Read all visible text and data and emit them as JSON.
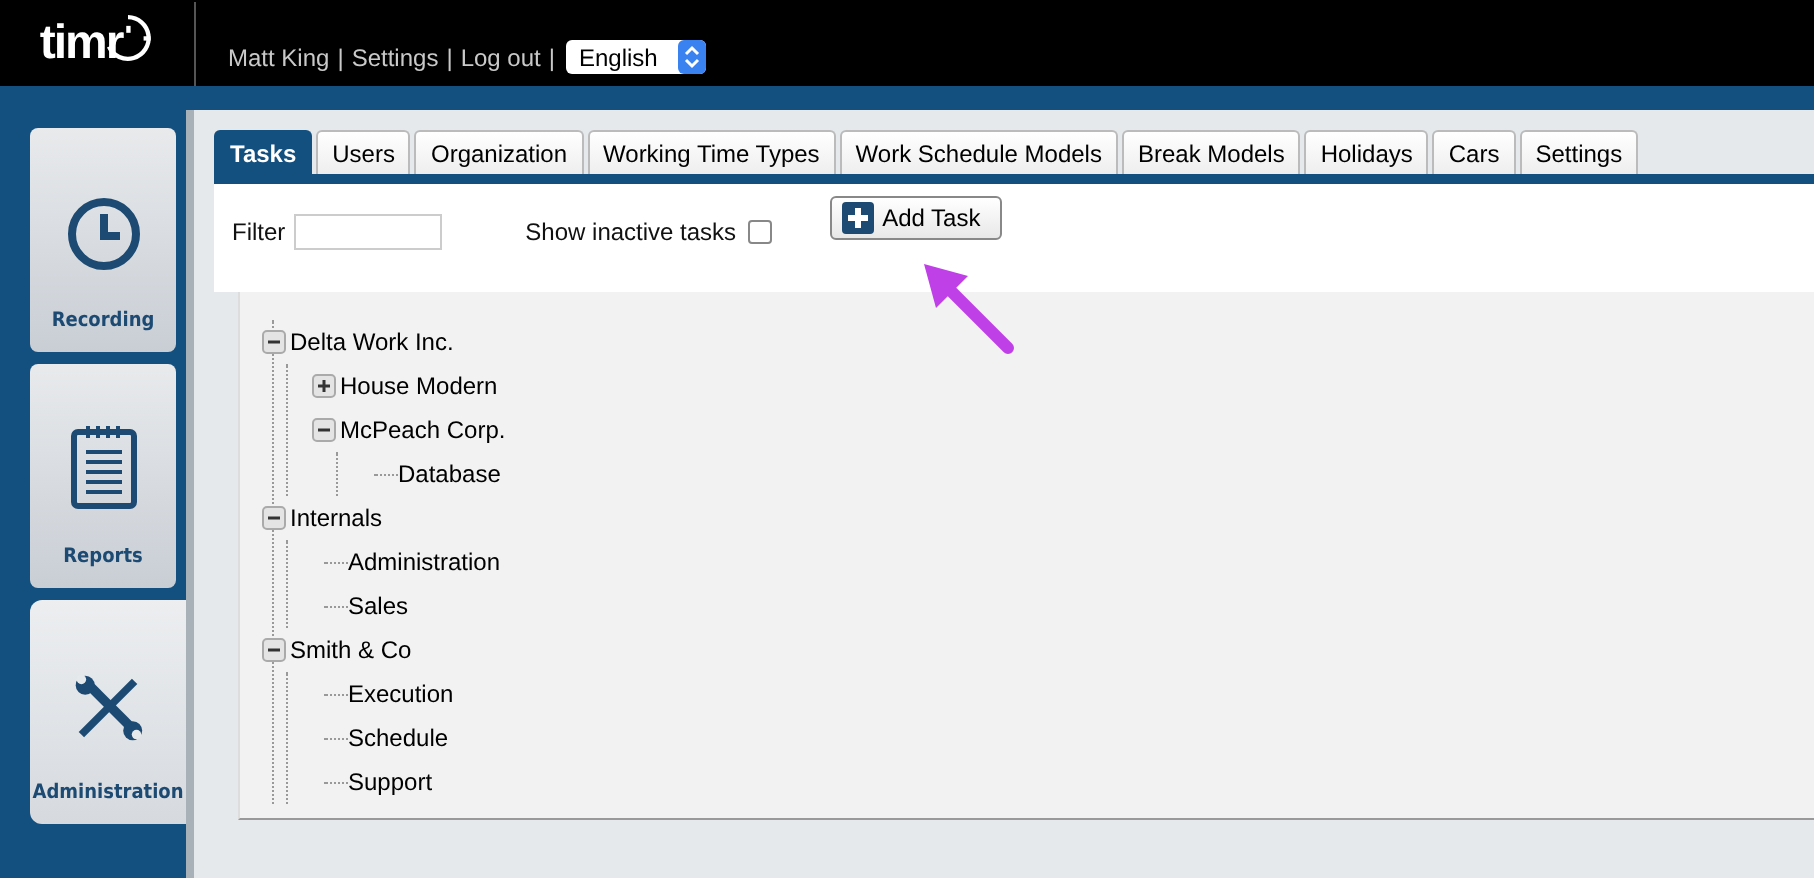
{
  "header": {
    "user": "Matt King",
    "separator_1": "|",
    "settings": "Settings",
    "separator_2": "|",
    "logout": "Log out",
    "separator_3": "|",
    "language": "English"
  },
  "logo": {
    "text": "timr"
  },
  "sidebar": {
    "items": [
      {
        "label": "Recording",
        "selected": false
      },
      {
        "label": "Reports",
        "selected": false
      },
      {
        "label": "Administration",
        "selected": true
      }
    ]
  },
  "tabs": [
    {
      "label": "Tasks",
      "selected": true
    },
    {
      "label": "Users",
      "selected": false
    },
    {
      "label": "Organization",
      "selected": false
    },
    {
      "label": "Working Time Types",
      "selected": false
    },
    {
      "label": "Work Schedule Models",
      "selected": false
    },
    {
      "label": "Break Models",
      "selected": false
    },
    {
      "label": "Holidays",
      "selected": false
    },
    {
      "label": "Cars",
      "selected": false
    },
    {
      "label": "Settings",
      "selected": false
    }
  ],
  "toolbar": {
    "filter_label": "Filter",
    "show_inactive_label": "Show inactive tasks",
    "show_inactive_checked": false,
    "add_button": "Add Task"
  },
  "tree": [
    {
      "label": "Delta Work Inc.",
      "expanded": true,
      "children": [
        {
          "label": "House Modern",
          "expanded": false
        },
        {
          "label": "McPeach Corp.",
          "expanded": true,
          "children": [
            {
              "label": "Database"
            }
          ]
        }
      ]
    },
    {
      "label": "Internals",
      "expanded": true,
      "children": [
        {
          "label": "Administration"
        },
        {
          "label": "Sales"
        }
      ]
    },
    {
      "label": "Smith & Co",
      "expanded": true,
      "children": [
        {
          "label": "Execution"
        },
        {
          "label": "Schedule"
        },
        {
          "label": "Support"
        }
      ]
    }
  ]
}
